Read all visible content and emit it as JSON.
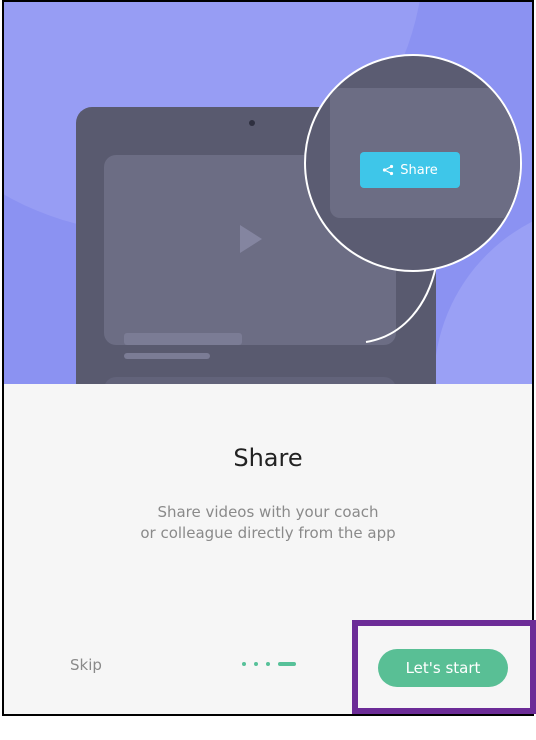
{
  "hero": {
    "share_button_label": "Share",
    "share_icon": "share-icon",
    "play_icon": "play-icon"
  },
  "content": {
    "title": "Share",
    "description_line1": "Share videos with your coach",
    "description_line2": "or colleague directly from the app"
  },
  "footer": {
    "skip_label": "Skip",
    "start_label": "Let's start",
    "page_count": 4,
    "current_page": 4
  },
  "colors": {
    "hero_bg": "#8b92f2",
    "accent_green": "#59bf95",
    "share_blue": "#3ec6e9",
    "highlight_purple": "#6c2c97"
  }
}
